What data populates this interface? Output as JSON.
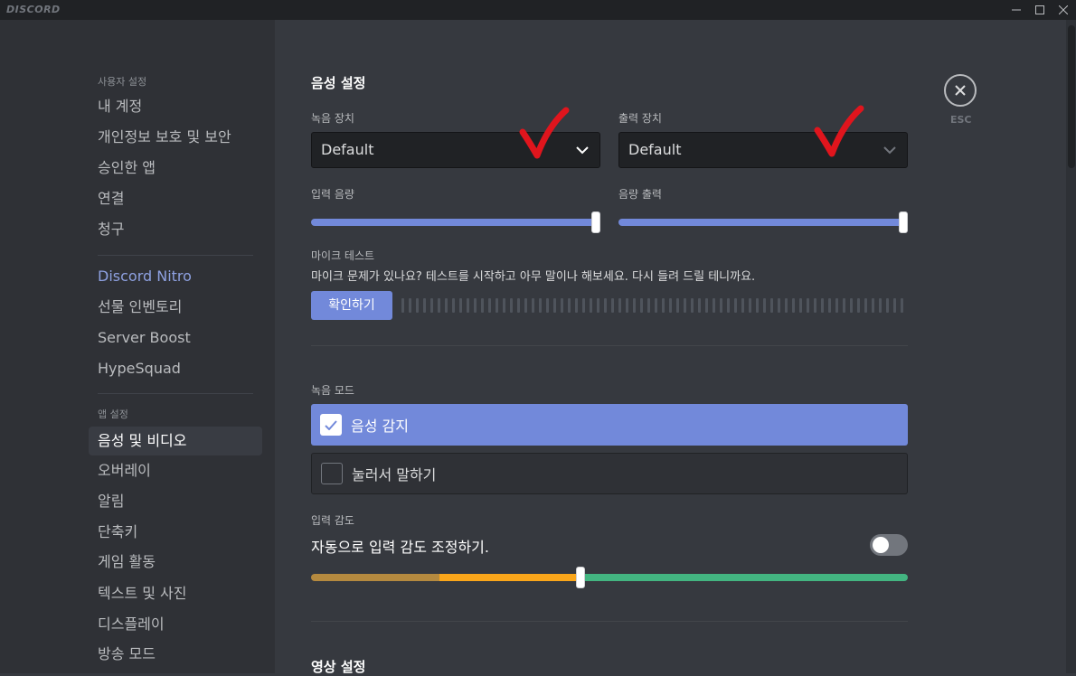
{
  "titlebar": {
    "logo": "DISCORD"
  },
  "sidebar": {
    "user_header": "사용자 설정",
    "user_items": [
      "내 계정",
      "개인정보 보호 및 보안",
      "승인한 앱",
      "연결",
      "청구"
    ],
    "nitro_items": [
      "Discord Nitro",
      "선물 인벤토리",
      "Server Boost",
      "HypeSquad"
    ],
    "app_header": "앱 설정",
    "app_items": [
      "음성 및 비디오",
      "오버레이",
      "알림",
      "단축키",
      "게임 활동",
      "텍스트 및 사진",
      "디스플레이",
      "방송 모드"
    ],
    "selected": "음성 및 비디오"
  },
  "voice": {
    "title": "음성 설정",
    "input_device_label": "녹음 장치",
    "input_device_value": "Default",
    "output_device_label": "출력 장치",
    "output_device_value": "Default",
    "input_volume_label": "입력 음량",
    "input_volume": 100,
    "output_volume_label": "음량 출력",
    "output_volume": 100,
    "mic_test_label": "마이크 테스트",
    "mic_test_desc": "마이크 문제가 있나요? 테스트를 시작하고 아무 말이나 해보세요. 다시 들려 드릴 테니까요.",
    "mic_test_button": "확인하기",
    "input_mode_label": "녹음 모드",
    "mode_voice_activity": "음성 감지",
    "mode_push_to_talk": "눌러서 말하기",
    "selected_mode": "음성 감지",
    "sensitivity_label": "입력 감도",
    "auto_sensitivity_text": "자동으로 입력 감도 조정하기.",
    "auto_sensitivity_enabled": false,
    "sensitivity_level": 0.45
  },
  "video": {
    "title": "영상 설정"
  },
  "close": {
    "label": "ESC"
  },
  "colors": {
    "accent": "#7289da",
    "annotation_check": "#e0151d",
    "meter_dark_yellow": "#b58a3f",
    "meter_yellow": "#faa61a",
    "meter_green": "#43b581"
  },
  "icons": [
    "chevron-down-icon",
    "check-icon",
    "close-icon",
    "minimize-icon",
    "maximize-icon"
  ]
}
